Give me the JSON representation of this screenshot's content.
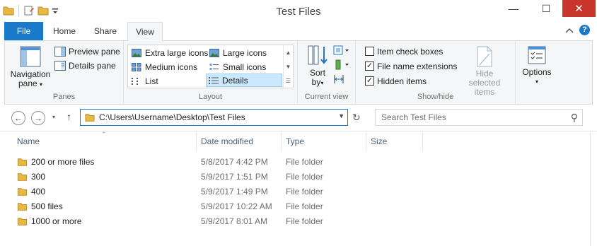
{
  "window": {
    "title": "Test Files",
    "minimize": "—",
    "maximize": "☐",
    "close": "✕"
  },
  "ribbon_tabs": {
    "file": "File",
    "home": "Home",
    "share": "Share",
    "view": "View"
  },
  "panes": {
    "navigation_pane_line1": "Navigation",
    "navigation_pane_line2": "pane",
    "preview_pane": "Preview pane",
    "details_pane": "Details pane",
    "label": "Panes"
  },
  "layout": {
    "extra_large_icons": "Extra large icons",
    "large_icons": "Large icons",
    "medium_icons": "Medium icons",
    "small_icons": "Small icons",
    "list": "List",
    "details": "Details",
    "label": "Layout"
  },
  "current_view": {
    "sort_line1": "Sort",
    "sort_line2": "by",
    "label": "Current view"
  },
  "show_hide": {
    "item_check_boxes": "Item check boxes",
    "item_check_boxes_checked": false,
    "file_name_extensions": "File name extensions",
    "file_name_extensions_checked": true,
    "hidden_items": "Hidden items",
    "hidden_items_checked": true,
    "hide_selected_line1": "Hide selected",
    "hide_selected_line2": "items",
    "label": "Show/hide"
  },
  "options": {
    "label": "Options"
  },
  "address_bar": {
    "path": "C:\\Users\\Username\\Desktop\\Test Files"
  },
  "search": {
    "placeholder": "Search Test Files"
  },
  "columns": {
    "name": "Name",
    "date_modified": "Date modified",
    "type": "Type",
    "size": "Size"
  },
  "files": [
    {
      "name": "200 or more files",
      "date": "5/8/2017 4:42 PM",
      "type": "File folder"
    },
    {
      "name": "300",
      "date": "5/9/2017 1:51 PM",
      "type": "File folder"
    },
    {
      "name": "400",
      "date": "5/9/2017 1:49 PM",
      "type": "File folder"
    },
    {
      "name": "500 files",
      "date": "5/9/2017 10:22 AM",
      "type": "File folder"
    },
    {
      "name": "1000 or more",
      "date": "5/9/2017 8:01 AM",
      "type": "File folder"
    }
  ],
  "colors": {
    "accent": "#1979ca",
    "close": "#c7352c",
    "folder": "#e8b83f"
  }
}
